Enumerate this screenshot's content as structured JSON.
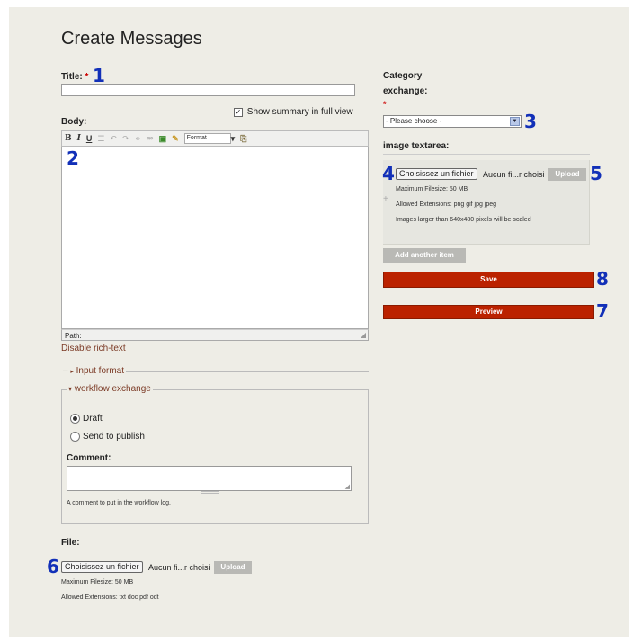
{
  "page_title": "Create Messages",
  "title_field": {
    "label": "Title:",
    "required": "*",
    "value": "",
    "marker": "1"
  },
  "summary": {
    "label": "Show summary in full view",
    "check": "✓"
  },
  "body": {
    "label": "Body:",
    "marker": "2",
    "toolbar": {
      "bold": "B",
      "italic": "I",
      "underline": "U",
      "list": "☰",
      "undo": "↶",
      "redo": "↷",
      "format_label": "Format",
      "format_arrow": "▾"
    },
    "path_label": "Path:",
    "disable_rich_text": "Disable rich-text"
  },
  "input_format": {
    "label": "Input format",
    "arrow": "▸",
    "dash": "–"
  },
  "workflow": {
    "legend": "workflow exchange",
    "arrow": "▾",
    "options": [
      "Draft",
      "Send to publish"
    ],
    "selected": "Draft",
    "comment_label": "Comment:",
    "comment_value": "",
    "comment_help": "A comment to put in the workflow log."
  },
  "file": {
    "label": "File:",
    "choose_label": "Choisissez un fichier",
    "no_file": "Aucun fi...r choisi",
    "upload_label": "Upload",
    "max_size": "Maximum Filesize: 50 MB",
    "allowed": "Allowed Extensions: txt doc pdf odt",
    "marker": "6"
  },
  "category": {
    "label_line1": "Category",
    "label_line2": "exchange:",
    "required": "*",
    "selected": "- Please choose -",
    "marker": "3"
  },
  "image": {
    "label": "image textarea:",
    "choose_label": "Choisissez un fichier",
    "no_file": "Aucun fi...r choisi",
    "upload_label": "Upload",
    "max_size": "Maximum Filesize: 50 MB",
    "allowed": "Allowed Extensions: png gif jpg jpeg",
    "scale_note": "Images larger than 640x480 pixels will be scaled",
    "drag_icon": "+",
    "add_another": "Add another item",
    "marker_choose": "4",
    "marker_upload": "5"
  },
  "actions": {
    "save": "Save",
    "preview": "Preview",
    "marker_save": "8",
    "marker_preview": "7"
  },
  "colors": {
    "accent": "#bb2200",
    "marker": "#1230b8",
    "link": "#7b3a25",
    "background": "#eeede6"
  }
}
